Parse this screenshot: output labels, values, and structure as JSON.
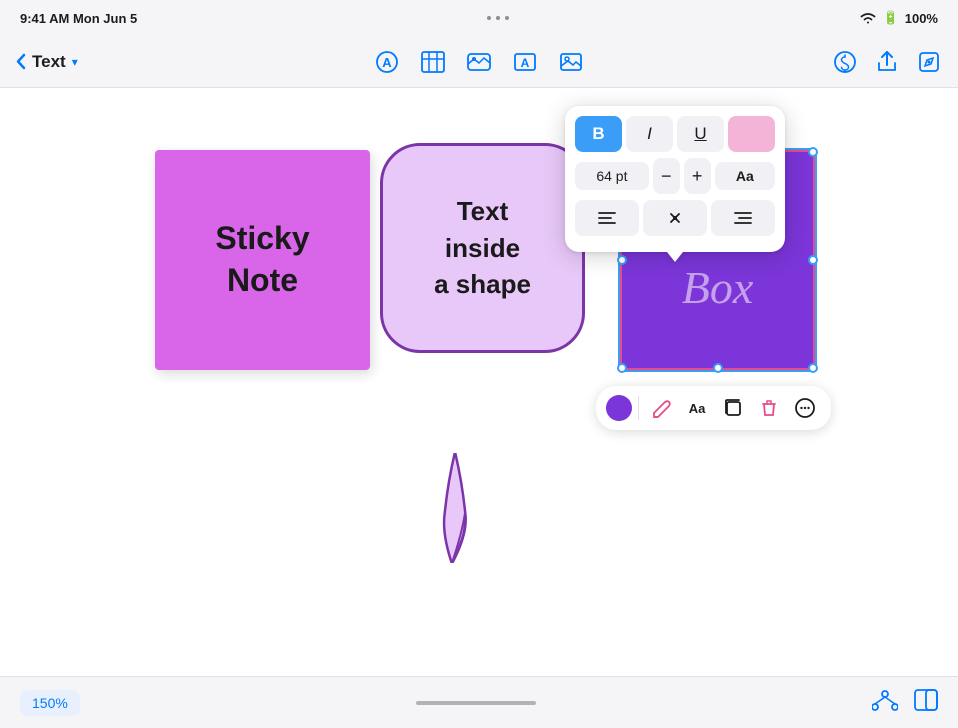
{
  "statusBar": {
    "time": "9:41 AM  Mon Jun 5",
    "wifi": "WiFi",
    "battery": "100%"
  },
  "toolbar": {
    "backLabel": "Text",
    "dropdownArrow": "▾",
    "icons": {
      "annotation": "A",
      "table": "⊞",
      "media": "⬚",
      "textBox": "A",
      "image": "⊡",
      "share": "↑",
      "more": "⋯",
      "edit": "✎",
      "coin": "©"
    }
  },
  "canvas": {
    "stickyNote": {
      "text": "Sticky\nNote"
    },
    "speechBubble": {
      "text": "Text\ninside\na shape"
    },
    "textBox": {
      "text": "Text\nBox"
    }
  },
  "formatPopup": {
    "boldLabel": "B",
    "italicLabel": "I",
    "underlineLabel": "U",
    "fontSize": "64 pt",
    "minus": "−",
    "plus": "+",
    "fontAa": "Aa",
    "alignLeft": "≡",
    "alignCenter": "⁂",
    "alignRight": "≡"
  },
  "contextToolbar": {
    "pencilIcon": "✏",
    "fontIcon": "Aa",
    "duplicateIcon": "⧉",
    "deleteIcon": "🗑",
    "moreIcon": "☺"
  },
  "bottomBar": {
    "zoomLevel": "150%"
  }
}
